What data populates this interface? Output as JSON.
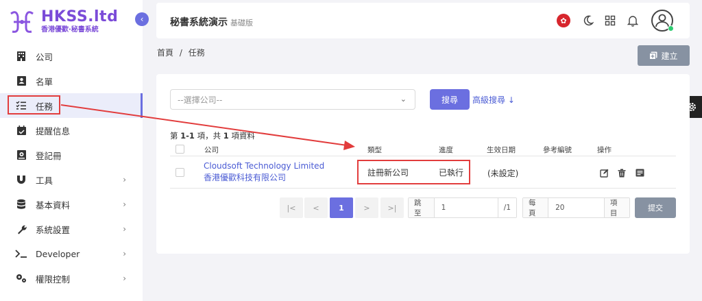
{
  "brand": {
    "title": "HKSS.ltd",
    "subtitle": "香港優歡·秘書系統",
    "color": "#7b4bd8"
  },
  "sidebar": {
    "items": [
      {
        "label": "公司",
        "icon": "building-icon"
      },
      {
        "label": "名單",
        "icon": "contact-card-icon"
      },
      {
        "label": "任務",
        "icon": "checklist-icon",
        "active": true
      },
      {
        "label": "提醒信息",
        "icon": "calendar-check-icon"
      },
      {
        "label": "登記冊",
        "icon": "register-book-icon"
      },
      {
        "label": "工具",
        "icon": "magnet-icon",
        "has_children": true
      },
      {
        "label": "基本資料",
        "icon": "database-icon",
        "has_children": true
      },
      {
        "label": "系統設置",
        "icon": "wrench-icon",
        "has_children": true
      },
      {
        "label": "Developer",
        "icon": "terminal-icon",
        "has_children": true
      },
      {
        "label": "權限控制",
        "icon": "cogs-icon",
        "has_children": true
      }
    ]
  },
  "header": {
    "title": "秘書系統演示",
    "edition": "基礎版"
  },
  "breadcrumb": {
    "home": "首頁",
    "separator": "/",
    "current": "任務"
  },
  "create_button": {
    "label": "建立"
  },
  "filter": {
    "company_placeholder": "--選擇公司--",
    "search_label": "搜尋",
    "advanced_label": "高級搜尋 ↓"
  },
  "summary": {
    "prefix": "第 ",
    "range": "1-1",
    "mid": " 項，共 ",
    "total": "1",
    "suffix": " 項資料"
  },
  "table": {
    "columns": [
      "公司",
      "類型",
      "進度",
      "生效日期",
      "參考編號",
      "操作"
    ],
    "rows": [
      {
        "company_en": "Cloudsoft Technology Limited",
        "company_zh": "香港優歡科技有限公司",
        "type": "註冊新公司",
        "progress": "已執行",
        "effective_date": "(未設定)",
        "reference": ""
      }
    ]
  },
  "pagination": {
    "first": "|<",
    "prev": "<",
    "current": "1",
    "next": ">",
    "last": ">|",
    "goto_label": "跳至",
    "goto_value": "1",
    "goto_total": "/1",
    "per_page_label": "每頁",
    "per_page_value": "20",
    "per_page_unit": "項目",
    "submit_label": "提交"
  },
  "colors": {
    "accent": "#6b6fe0",
    "annotation": "#e23c3c",
    "link": "#4a5bd4"
  }
}
